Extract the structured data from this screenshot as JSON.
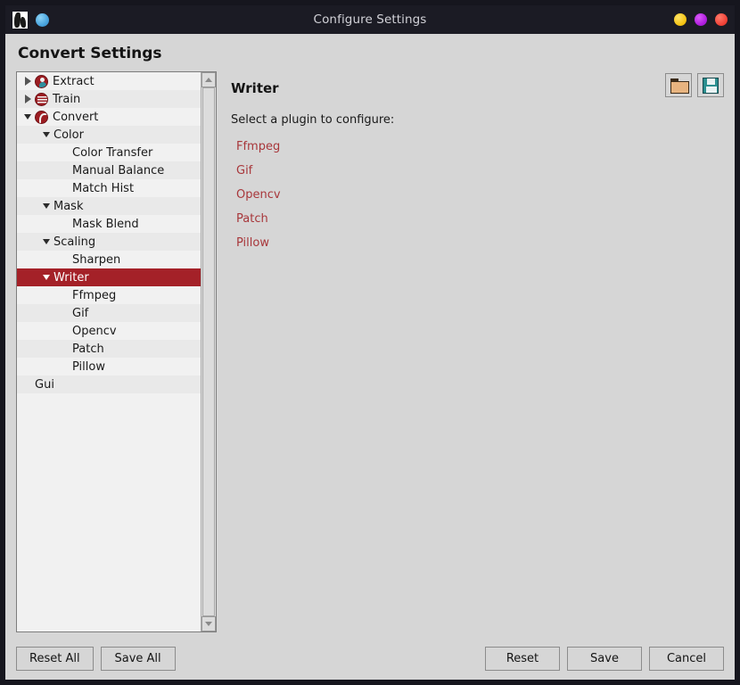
{
  "titlebar": {
    "title": "Configure Settings",
    "logo_icon": "app-logo-icon",
    "accent_icon": "blue-circle-icon",
    "controls": [
      {
        "name": "minimize-button",
        "color": "#f5c518"
      },
      {
        "name": "maximize-button",
        "color": "#b21fe0"
      },
      {
        "name": "close-button",
        "color": "#f1453a"
      }
    ]
  },
  "page": {
    "title": "Convert Settings"
  },
  "tree": {
    "items": [
      {
        "label": "Extract",
        "depth": 0,
        "expander": "collapsed",
        "icon": "extract",
        "selected": false,
        "alt": false
      },
      {
        "label": "Train",
        "depth": 0,
        "expander": "collapsed",
        "icon": "train",
        "selected": false,
        "alt": true
      },
      {
        "label": "Convert",
        "depth": 0,
        "expander": "expanded",
        "icon": "convert",
        "selected": false,
        "alt": false
      },
      {
        "label": "Color",
        "depth": 1,
        "expander": "expanded",
        "icon": "",
        "selected": false,
        "alt": true
      },
      {
        "label": "Color Transfer",
        "depth": 2,
        "expander": "none",
        "icon": "",
        "selected": false,
        "alt": false
      },
      {
        "label": "Manual Balance",
        "depth": 2,
        "expander": "none",
        "icon": "",
        "selected": false,
        "alt": true
      },
      {
        "label": "Match Hist",
        "depth": 2,
        "expander": "none",
        "icon": "",
        "selected": false,
        "alt": false
      },
      {
        "label": "Mask",
        "depth": 1,
        "expander": "expanded",
        "icon": "",
        "selected": false,
        "alt": true
      },
      {
        "label": "Mask Blend",
        "depth": 2,
        "expander": "none",
        "icon": "",
        "selected": false,
        "alt": false
      },
      {
        "label": "Scaling",
        "depth": 1,
        "expander": "expanded",
        "icon": "",
        "selected": false,
        "alt": true
      },
      {
        "label": "Sharpen",
        "depth": 2,
        "expander": "none",
        "icon": "",
        "selected": false,
        "alt": false
      },
      {
        "label": "Writer",
        "depth": 1,
        "expander": "expanded",
        "icon": "",
        "selected": true,
        "alt": true
      },
      {
        "label": "Ffmpeg",
        "depth": 2,
        "expander": "none",
        "icon": "",
        "selected": false,
        "alt": false
      },
      {
        "label": "Gif",
        "depth": 2,
        "expander": "none",
        "icon": "",
        "selected": false,
        "alt": true
      },
      {
        "label": "Opencv",
        "depth": 2,
        "expander": "none",
        "icon": "",
        "selected": false,
        "alt": false
      },
      {
        "label": "Patch",
        "depth": 2,
        "expander": "none",
        "icon": "",
        "selected": false,
        "alt": true
      },
      {
        "label": "Pillow",
        "depth": 2,
        "expander": "none",
        "icon": "",
        "selected": false,
        "alt": false
      },
      {
        "label": "Gui",
        "depth": 0,
        "expander": "none",
        "icon": "",
        "selected": false,
        "alt": true
      }
    ],
    "scrollbar": {
      "up_icon": "scroll-up-arrow-icon",
      "down_icon": "scroll-down-arrow-icon"
    }
  },
  "panel": {
    "toolbar": [
      {
        "name": "load-settings-button",
        "icon": "folder-open-icon"
      },
      {
        "name": "save-settings-button",
        "icon": "floppy-save-icon"
      }
    ],
    "title": "Writer",
    "subtitle": "Select a plugin to configure:",
    "plugins": [
      {
        "label": "Ffmpeg"
      },
      {
        "label": "Gif"
      },
      {
        "label": "Opencv"
      },
      {
        "label": "Patch"
      },
      {
        "label": "Pillow"
      }
    ],
    "link_color": "#a8373b"
  },
  "footer": {
    "left": [
      {
        "name": "reset-all-button",
        "label": "Reset All"
      },
      {
        "name": "save-all-button",
        "label": "Save All"
      }
    ],
    "right": [
      {
        "name": "reset-button",
        "label": "Reset"
      },
      {
        "name": "save-button",
        "label": "Save"
      },
      {
        "name": "cancel-button",
        "label": "Cancel"
      }
    ]
  },
  "colors": {
    "selection": "#a42128",
    "window_chrome": "#16161e",
    "dialog_bg": "#d6d6d6",
    "tree_bg": "#f1f1f1",
    "tree_alt_row": "#e9e9e9"
  }
}
